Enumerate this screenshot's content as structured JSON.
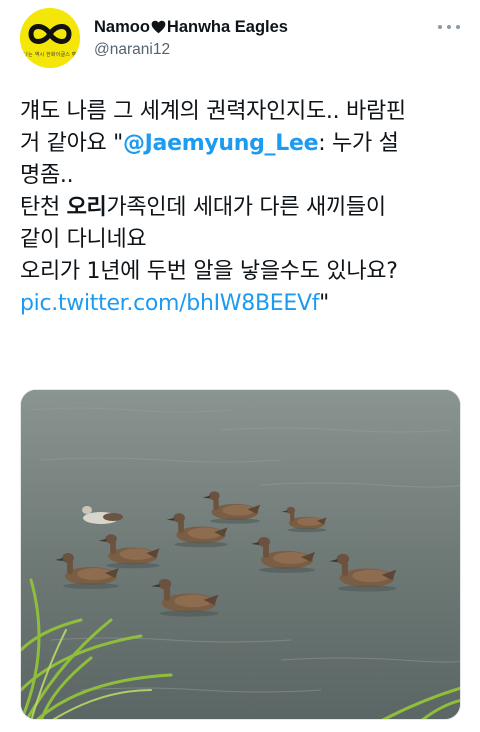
{
  "author": {
    "display_name_left": "Namoo",
    "display_name_right": "Hanwha Eagles",
    "handle": "@narani12",
    "avatar_caption": "나는 역시 한화이글스 팬"
  },
  "tweet": {
    "line1": "걔도 나름 그 세계의 권력자인지도.. 바람핀",
    "line2_prefix": "거 같아요 \"",
    "mention": "@Jaemyung_Lee",
    "line2_suffix": ": 누가 설",
    "line3": "명좀..",
    "line4_prefix": "탄천 ",
    "line4_bold": "오리",
    "line4_suffix": "가족인데 세대가 다른 새끼들이",
    "line5": "같이 다니네요",
    "line6": "오리가 1년에 두번 알을 낳을수도 있나요?",
    "link": "pic.twitter.com/bhIW8BEEVf",
    "link_suffix": "\""
  },
  "icons": {
    "heart": "heart-icon",
    "more": "more-options-icon",
    "avatar": "infinity-logo"
  },
  "colors": {
    "link": "#1d9bf0",
    "text": "#0f1419",
    "muted": "#536471",
    "avatar_bg": "#f5e60a"
  }
}
